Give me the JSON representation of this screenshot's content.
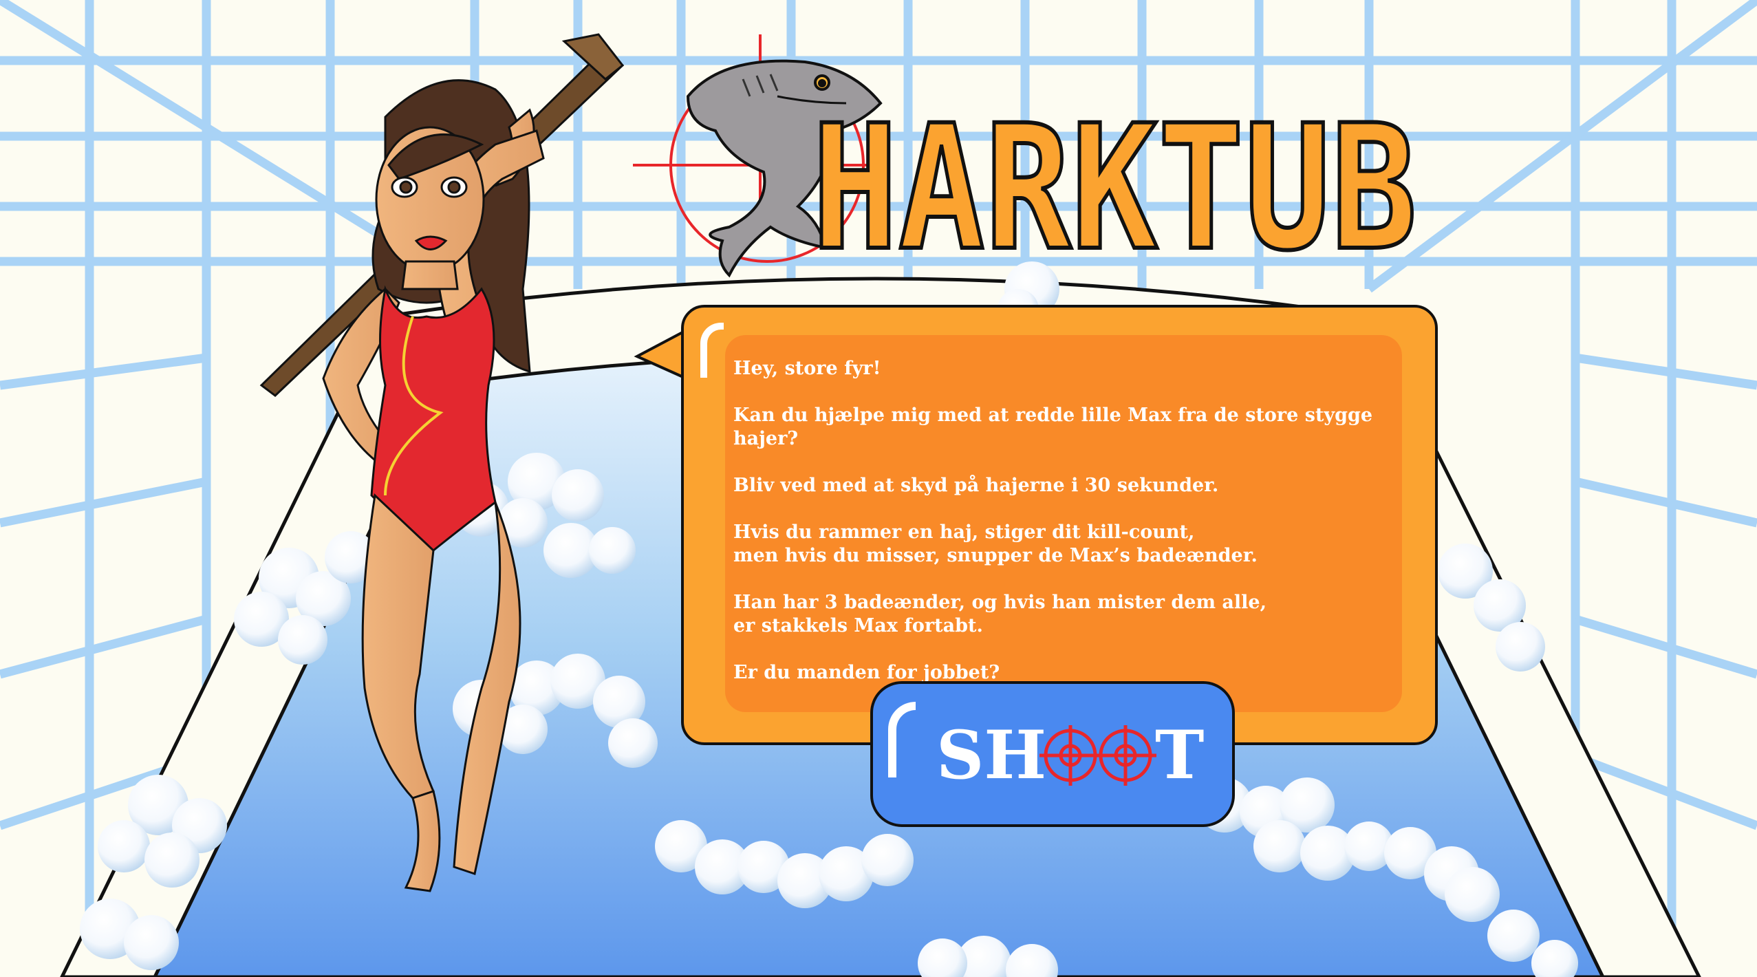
{
  "game": {
    "title": "HARKTUB"
  },
  "dialog": {
    "lines": [
      "Hey, store fyr!",
      "Kan du hjælpe mig med at  redde lille Max fra de store stygge hajer?",
      "Bliv ved med at skyd på hajerne i 30 sekunder.",
      "Hvis du rammer en haj, stiger dit kill-count,\nmen hvis du misser, snupper de Max’s badeænder.",
      "Han har 3 badeænder, og hvis han mister dem alle,\ner stakkels Max fortabt.",
      "Er du manden for jobbet?"
    ]
  },
  "shoot_button": {
    "label_start": "SH",
    "label_end": "T"
  },
  "colors": {
    "title_orange": "#fba330",
    "dialog_orange": "#f98a28",
    "button_blue": "#4a89f0",
    "crosshair_red": "#e8262a",
    "swimsuit_red": "#e3282f",
    "tile_blue": "#a9d3f6"
  }
}
